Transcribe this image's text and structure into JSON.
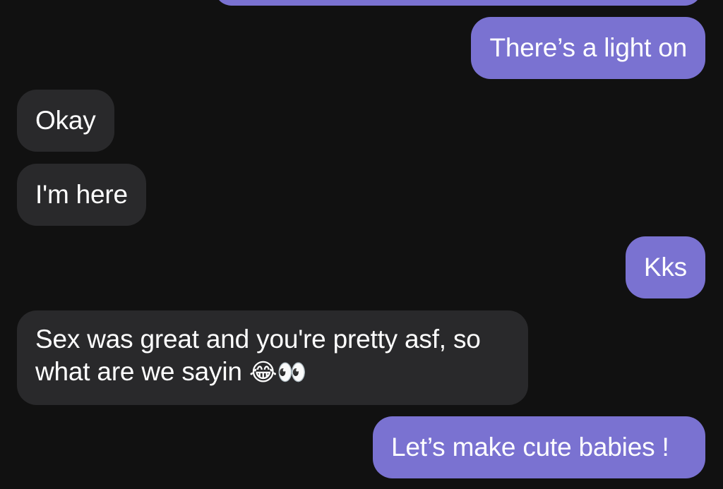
{
  "colors": {
    "background": "#111111",
    "sent_bubble": "#7a72d1",
    "received_bubble": "#29292b",
    "text": "#ffffff"
  },
  "messages": [
    {
      "id": "m0",
      "sender": "me",
      "text": ""
    },
    {
      "id": "m1",
      "sender": "me",
      "text": "There’s a light on"
    },
    {
      "id": "m2",
      "sender": "them",
      "text": "Okay"
    },
    {
      "id": "m3",
      "sender": "them",
      "text": "I'm here"
    },
    {
      "id": "m4",
      "sender": "me",
      "text": "Kks"
    },
    {
      "id": "m5",
      "sender": "them",
      "line1": "Sex was great and you're pretty asf, so",
      "line2": "what are we sayin",
      "emoji": "😂👀"
    },
    {
      "id": "m6",
      "sender": "me",
      "text": "Let’s make cute babies !"
    }
  ]
}
